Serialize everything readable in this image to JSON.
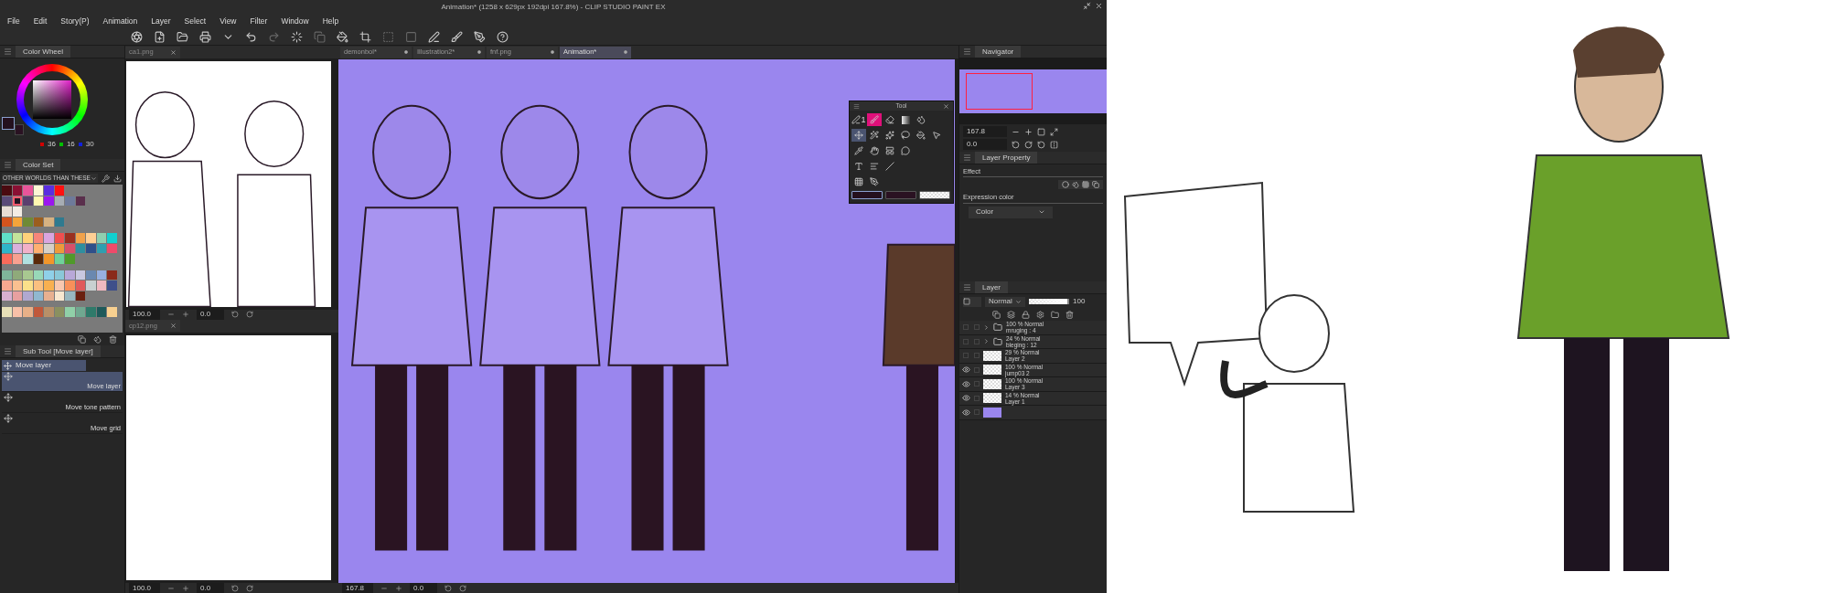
{
  "window": {
    "title": "Animation* (1258 x 629px 192dpi 167.8%) - CLIP STUDIO PAINT EX"
  },
  "menu": [
    "File",
    "Edit",
    "Story(P)",
    "Animation",
    "Layer",
    "Select",
    "View",
    "Filter",
    "Window",
    "Help"
  ],
  "color_wheel": {
    "tab": "Color Wheel",
    "r": "36",
    "g": "16",
    "b": "30"
  },
  "color_set": {
    "tab": "Color Set",
    "set_name": "OTHER WORLDS THAN THESE",
    "groups": [
      [
        [
          {
            "color": "#4a0a10",
            "selected": false
          },
          {
            "color": "#8a0f33",
            "selected": false
          },
          {
            "color": "#e9559a",
            "selected": false
          },
          {
            "color": "#fdf7d4",
            "selected": false
          },
          {
            "color": "#5a2ee0",
            "selected": false
          },
          {
            "color": "#ff1010",
            "selected": false
          }
        ],
        [
          {
            "color": "#5a4a78",
            "selected": false
          },
          {
            "color": "#221522",
            "selected": true
          },
          {
            "color": "#5a3f6e",
            "selected": false
          },
          {
            "color": "#fff8b0",
            "selected": false
          },
          {
            "color": "#9b16f0",
            "selected": false
          },
          {
            "color": "#a7adb4",
            "selected": false
          },
          {
            "color": "#6e7a9a",
            "selected": false
          },
          {
            "color": "#5a2f4c",
            "selected": false
          }
        ],
        [
          {
            "color": "#e8ddd5",
            "selected": false
          },
          {
            "color": "#f3ece4",
            "selected": false
          }
        ],
        [
          {
            "color": "#d4541e",
            "selected": false
          },
          {
            "color": "#f4a43a",
            "selected": false
          },
          {
            "color": "#6f8a35",
            "selected": false
          },
          {
            "color": "#9b5e1e",
            "selected": false
          },
          {
            "color": "#d6b282",
            "selected": false
          },
          {
            "color": "#2f7a8f",
            "selected": false
          }
        ]
      ],
      [
        [
          {
            "color": "#5fe0c8",
            "selected": false
          },
          {
            "color": "#c3e39a",
            "selected": false
          },
          {
            "color": "#ffd27a",
            "selected": false
          },
          {
            "color": "#f7857a",
            "selected": false
          },
          {
            "color": "#d9a5e0",
            "selected": false
          },
          {
            "color": "#ef4f4f",
            "selected": false
          },
          {
            "color": "#9a3020",
            "selected": false
          },
          {
            "color": "#f2a24a",
            "selected": false
          },
          {
            "color": "#ffcf94",
            "selected": false
          },
          {
            "color": "#8fcfb0",
            "selected": false
          },
          {
            "color": "#10d0d0",
            "selected": false
          }
        ],
        [
          {
            "color": "#2fb5c8",
            "selected": false
          },
          {
            "color": "#d9b0dc",
            "selected": false
          },
          {
            "color": "#f2b0c8",
            "selected": false
          },
          {
            "color": "#ffb070",
            "selected": false
          },
          {
            "color": "#d6d0c8",
            "selected": false
          },
          {
            "color": "#ee9a3a",
            "selected": false
          },
          {
            "color": "#d7506a",
            "selected": false
          },
          {
            "color": "#2f8f9f",
            "selected": false
          },
          {
            "color": "#2f4f8a",
            "selected": false
          },
          {
            "color": "#2f9fb0",
            "selected": false
          },
          {
            "color": "#ef4a6a",
            "selected": false
          }
        ],
        [
          {
            "color": "#f96a5a",
            "selected": false
          },
          {
            "color": "#f8a090",
            "selected": false
          },
          {
            "color": "#b0e0e0",
            "selected": false
          },
          {
            "color": "#5a2a0a",
            "selected": false
          },
          {
            "color": "#f2962a",
            "selected": false
          },
          {
            "color": "#6fd29a",
            "selected": false
          },
          {
            "color": "#4f9a2a",
            "selected": false
          }
        ]
      ],
      [
        [
          {
            "color": "#7fb59a",
            "selected": false
          },
          {
            "color": "#8faa7a",
            "selected": false
          },
          {
            "color": "#a8c890",
            "selected": false
          },
          {
            "color": "#98d8b8",
            "selected": false
          },
          {
            "color": "#8fd0e8",
            "selected": false
          },
          {
            "color": "#8ac8d8",
            "selected": false
          },
          {
            "color": "#b8a8d8",
            "selected": false
          },
          {
            "color": "#c8c8e0",
            "selected": false
          },
          {
            "color": "#6a88b0",
            "selected": false
          },
          {
            "color": "#98b0e0",
            "selected": false
          },
          {
            "color": "#8a2a1a",
            "selected": false
          }
        ],
        [
          {
            "color": "#f8a890",
            "selected": false
          },
          {
            "color": "#fac090",
            "selected": false
          },
          {
            "color": "#fae08a",
            "selected": false
          },
          {
            "color": "#fac080",
            "selected": false
          },
          {
            "color": "#f8b050",
            "selected": false
          },
          {
            "color": "#f8c8b0",
            "selected": false
          },
          {
            "color": "#f8905a",
            "selected": false
          },
          {
            "color": "#e05a5a",
            "selected": false
          },
          {
            "color": "#c8d0d0",
            "selected": false
          },
          {
            "color": "#f0b8c0",
            "selected": false
          },
          {
            "color": "#3f4f8a",
            "selected": false
          }
        ],
        [
          {
            "color": "#d8b0d0",
            "selected": false
          },
          {
            "color": "#e8a0a0",
            "selected": false
          },
          {
            "color": "#b0a8d0",
            "selected": false
          },
          {
            "color": "#90b8d0",
            "selected": false
          },
          {
            "color": "#e8b090",
            "selected": false
          },
          {
            "color": "#f8e8d0",
            "selected": false
          },
          {
            "color": "#98b8c0",
            "selected": false
          },
          {
            "color": "#6a2010",
            "selected": false
          }
        ]
      ],
      [
        [
          {
            "color": "#e8e0b8",
            "selected": false
          },
          {
            "color": "#f8c0a8",
            "selected": false
          },
          {
            "color": "#e8b088",
            "selected": false
          },
          {
            "color": "#c0583a",
            "selected": false
          },
          {
            "color": "#b89068",
            "selected": false
          },
          {
            "color": "#8a9060",
            "selected": false
          },
          {
            "color": "#90d0a8",
            "selected": false
          },
          {
            "color": "#70a890",
            "selected": false
          },
          {
            "color": "#2f7a6a",
            "selected": false
          },
          {
            "color": "#1f5a5a",
            "selected": false
          },
          {
            "color": "#f8d090",
            "selected": false
          }
        ]
      ]
    ]
  },
  "sub_tool": {
    "tab": "Sub Tool [Move layer]",
    "group": "Move layer",
    "items": [
      {
        "label": "Move layer",
        "selected": true
      },
      {
        "label": "Move tone pattern",
        "selected": false
      },
      {
        "label": "Move grid",
        "selected": false
      }
    ]
  },
  "side_canvases": [
    {
      "tab": "ca1.png",
      "zoom": "100.0",
      "angle": "0.0",
      "kind": "sketch"
    },
    {
      "tab": "cp12.png",
      "zoom": "100.0",
      "angle": "0.0",
      "kind": "blank"
    }
  ],
  "main_canvas": {
    "tabs": [
      {
        "label": "demonbol*",
        "selected": false
      },
      {
        "label": "Illustration2*",
        "selected": false
      },
      {
        "label": "fnf.png",
        "selected": false
      },
      {
        "label": "Animation*",
        "selected": true
      }
    ],
    "zoom": "167.8",
    "angle": "0.0"
  },
  "tool_palette": {
    "title": "Tool",
    "pen_number": "1",
    "rows": [
      [
        {
          "kind": "pen",
          "selected": false
        },
        {
          "kind": "airbrush",
          "selected": false
        },
        {
          "kind": "eraser",
          "selected": false
        },
        {
          "kind": "gradient",
          "selected": false
        },
        {
          "kind": "blend",
          "selected": false
        }
      ],
      [
        {
          "kind": "move",
          "selected": true
        },
        {
          "kind": "wand",
          "selected": false
        },
        {
          "kind": "broom",
          "selected": false
        },
        {
          "kind": "lasso",
          "selected": false
        },
        {
          "kind": "fill",
          "selected": false
        },
        {
          "kind": "pointer",
          "selected": false
        }
      ],
      [
        {
          "kind": "eyedropper",
          "selected": false
        },
        {
          "kind": "hand",
          "selected": false
        },
        {
          "kind": "frame",
          "selected": false
        },
        {
          "kind": "balloon",
          "selected": false
        }
      ],
      [
        {
          "kind": "text",
          "selected": false
        },
        {
          "kind": "lines",
          "selected": false
        },
        {
          "kind": "line",
          "selected": false
        }
      ],
      [
        {
          "kind": "pattern",
          "selected": false
        },
        {
          "kind": "nib",
          "selected": false
        }
      ]
    ],
    "colors": [
      {
        "kind": "main",
        "selected": true
      },
      {
        "kind": "sub",
        "selected": false
      },
      {
        "kind": "transparent",
        "selected": false
      }
    ]
  },
  "navigator": {
    "tab": "Navigator",
    "zoom": "167.8",
    "angle": "0.0"
  },
  "layer_property": {
    "tab": "Layer Property",
    "effect_label": "Effect",
    "expression_label": "Expression color",
    "expression_value": "Color"
  },
  "layers": {
    "tab": "Layer",
    "blend": "Normal",
    "opacity": "100",
    "opacity_slider": {
      "level": 1
    },
    "items": [
      {
        "kind": "folder",
        "mode": "100 % Normal",
        "name": "mruging : 4",
        "visible": false
      },
      {
        "kind": "folder",
        "mode": "24 % Normal",
        "name": "bleging : 12",
        "visible": false
      },
      {
        "kind": "raster",
        "mode": "29 % Normal",
        "name": "Layer 2",
        "visible": false
      },
      {
        "kind": "raster",
        "mode": "100 % Normal",
        "name": "jump03 2",
        "visible": true
      },
      {
        "kind": "raster",
        "mode": "100 % Normal",
        "name": "Layer 3",
        "visible": true
      },
      {
        "kind": "raster",
        "mode": "14 % Normal",
        "name": "Layer 1",
        "visible": true
      },
      {
        "kind": "paper",
        "visible": true
      }
    ]
  }
}
